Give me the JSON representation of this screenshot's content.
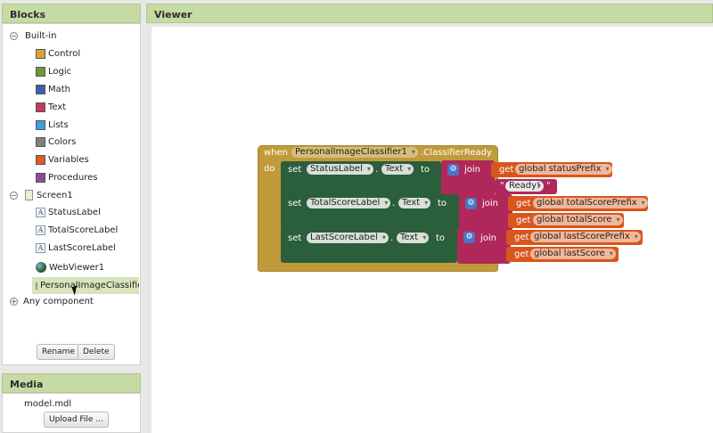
{
  "blocks_panel": {
    "title": "Blocks",
    "builtin_label": "Built-in",
    "builtin": [
      {
        "label": "Control",
        "color": "#d9a437"
      },
      {
        "label": "Logic",
        "color": "#6c9b3a"
      },
      {
        "label": "Math",
        "color": "#3a5fb0"
      },
      {
        "label": "Text",
        "color": "#c4385c"
      },
      {
        "label": "Lists",
        "color": "#3ea0d8"
      },
      {
        "label": "Colors",
        "color": "#808080"
      },
      {
        "label": "Variables",
        "color": "#e05a23"
      },
      {
        "label": "Procedures",
        "color": "#8a4aa0"
      }
    ],
    "screen_label": "Screen1",
    "components": [
      "StatusLabel",
      "TotalScoreLabel",
      "LastScoreLabel",
      "WebViewer1",
      "PersonalImageClassifier1"
    ],
    "any_component": "Any component",
    "rename": "Rename",
    "delete": "Delete"
  },
  "media": {
    "title": "Media",
    "file": "model.mdl",
    "upload": "Upload File ..."
  },
  "viewer": {
    "title": "Viewer",
    "event": {
      "when": "when",
      "component": "PersonalImageClassifier1",
      "event_name": ".ClassifierReady",
      "do": "do"
    },
    "set_kw": "set",
    "to_kw": "to",
    "dot": ".",
    "join_kw": "join",
    "get_kw": "get",
    "text_prop": "Text",
    "rows": [
      {
        "target": "StatusLabel",
        "gets": [
          "global statusPrefix"
        ],
        "literal": "Ready!"
      },
      {
        "target": "TotalScoreLabel",
        "gets": [
          "global totalScorePrefix",
          "global totalScore"
        ]
      },
      {
        "target": "LastScoreLabel",
        "gets": [
          "global lastScorePrefix",
          "global lastScore"
        ]
      }
    ],
    "quote": "\""
  }
}
